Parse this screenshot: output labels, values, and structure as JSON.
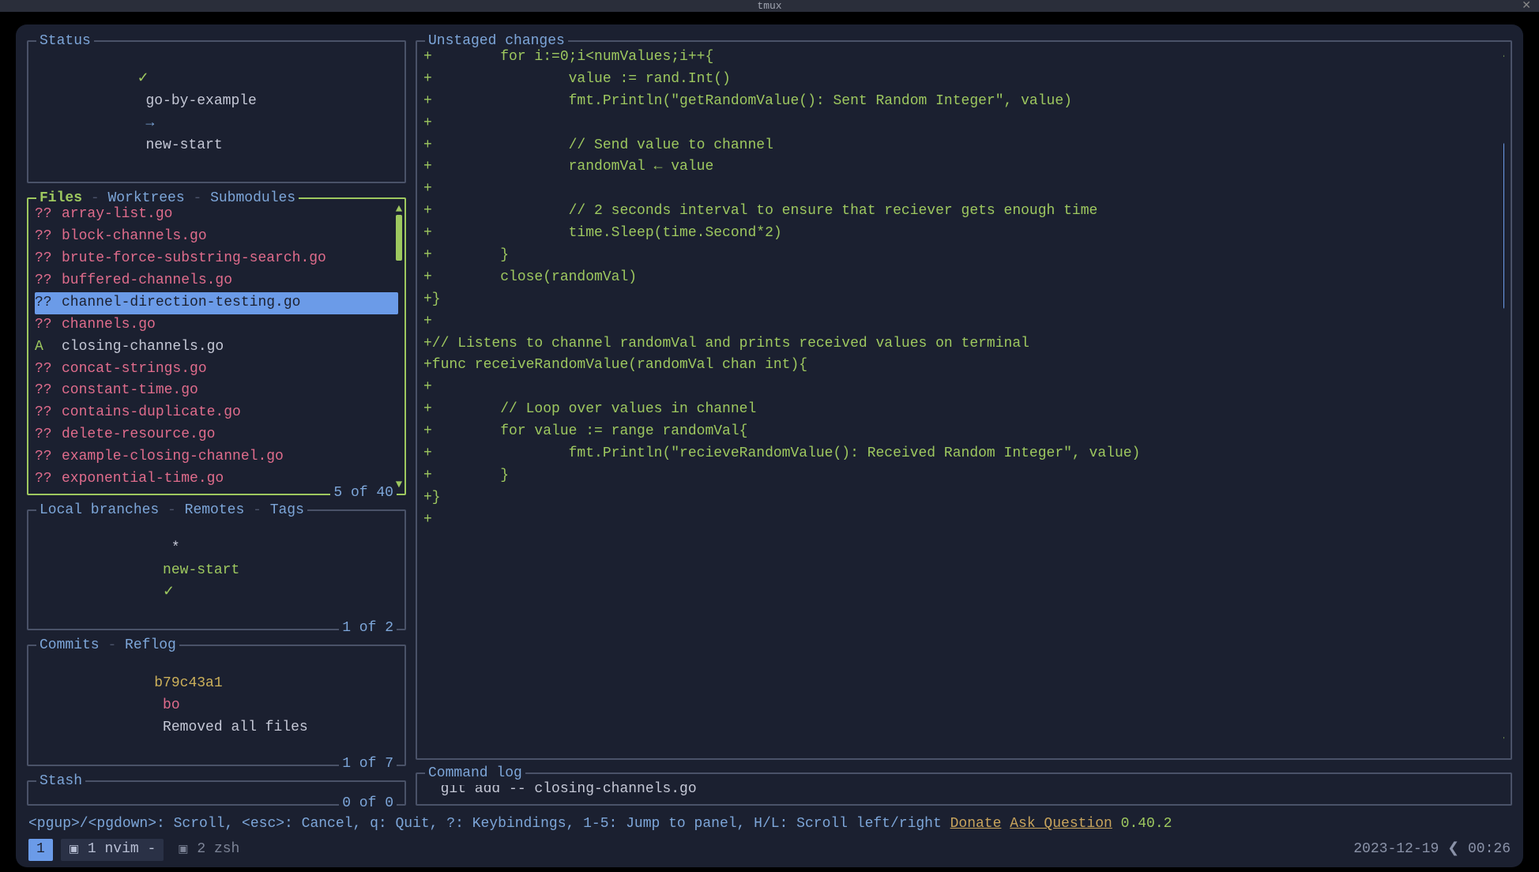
{
  "window": {
    "title": "tmux"
  },
  "status": {
    "title": "Status",
    "check": "✓",
    "repo": "go-by-example",
    "arrow": "→",
    "branch": "new-start"
  },
  "files": {
    "tabs": {
      "active": "Files",
      "t2": "Worktrees",
      "t3": "Submodules"
    },
    "footer": "5 of 40",
    "items": [
      {
        "status": "??",
        "name": "array-list.go",
        "added": false,
        "selected": false
      },
      {
        "status": "??",
        "name": "block-channels.go",
        "added": false,
        "selected": false
      },
      {
        "status": "??",
        "name": "brute-force-substring-search.go",
        "added": false,
        "selected": false
      },
      {
        "status": "??",
        "name": "buffered-channels.go",
        "added": false,
        "selected": false
      },
      {
        "status": "??",
        "name": "channel-direction-testing.go",
        "added": false,
        "selected": true
      },
      {
        "status": "??",
        "name": "channels.go",
        "added": false,
        "selected": false
      },
      {
        "status": "A ",
        "name": "closing-channels.go",
        "added": true,
        "selected": false
      },
      {
        "status": "??",
        "name": "concat-strings.go",
        "added": false,
        "selected": false
      },
      {
        "status": "??",
        "name": "constant-time.go",
        "added": false,
        "selected": false
      },
      {
        "status": "??",
        "name": "contains-duplicate.go",
        "added": false,
        "selected": false
      },
      {
        "status": "??",
        "name": "delete-resource.go",
        "added": false,
        "selected": false
      },
      {
        "status": "??",
        "name": "example-closing-channel.go",
        "added": false,
        "selected": false
      },
      {
        "status": "??",
        "name": "exponential-time.go",
        "added": false,
        "selected": false
      }
    ]
  },
  "branches": {
    "tabs": {
      "active": "Local branches",
      "t2": "Remotes",
      "t3": "Tags"
    },
    "footer": "1 of 2",
    "line": {
      "star": "*",
      "name": "new-start",
      "check": "✓"
    }
  },
  "commits": {
    "tabs": {
      "active": "Commits",
      "t2": "Reflog"
    },
    "footer": "1 of 7",
    "line": {
      "hash": "b79c43a1",
      "author": "bo",
      "msg": "Removed all files"
    }
  },
  "stash": {
    "title": "Stash",
    "footer": "0 of 0"
  },
  "diff": {
    "title": "Unstaged changes",
    "lines": [
      "+        for i:=0;i<numValues;i++{",
      "+                value := rand.Int()",
      "+                fmt.Println(\"getRandomValue(): Sent Random Integer\", value)",
      "+",
      "+                // Send value to channel",
      "+                randomVal ← value",
      "+",
      "+                // 2 seconds interval to ensure that reciever gets enough time",
      "+                time.Sleep(time.Second*2)",
      "+        }",
      "+        close(randomVal)",
      "+}",
      "+",
      "+// Listens to channel randomVal and prints received values on terminal",
      "+func receiveRandomValue(randomVal chan int){",
      "+",
      "+        // Loop over values in channel",
      "+        for value := range randomVal{",
      "+                fmt.Println(\"recieveRandomValue(): Received Random Integer\", value)",
      "+        }",
      "+}",
      "+"
    ]
  },
  "cmdlog": {
    "title": "Command log",
    "text": "  git add -- closing-channels.go"
  },
  "help": {
    "text": "<pgup>/<pgdown>: Scroll, <esc>: Cancel, q: Quit, ?: Keybindings, 1-5: Jump to panel, H/L: Scroll left/right  ",
    "donate": "Donate",
    "ask": "Ask Question",
    "version": "0.40.2"
  },
  "tmux": {
    "session": "1",
    "win1": {
      "icon": "▣",
      "label": "1 nvim",
      "suffix": "-"
    },
    "win2": {
      "icon": "▣",
      "label": "2 zsh"
    },
    "date": "2023-12-19",
    "sep": "❮",
    "time": "00:26"
  }
}
